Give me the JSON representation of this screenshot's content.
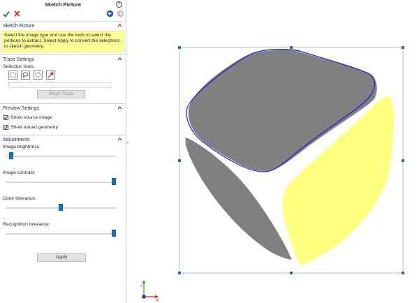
{
  "panel": {
    "title": "Sketch Picture",
    "help_icon": "?",
    "ok_icon": "check-icon",
    "cancel_icon": "x-icon"
  },
  "sketch_picture": {
    "heading": "Sketch Picture",
    "message": "Select the image type and use the tools to select the portions to extract. Select Apply to convert the selections to sketch geometry."
  },
  "trace_settings": {
    "heading": "Trace Settings",
    "selection_label": "Selection tools:",
    "tools": [
      "rectangle-select-icon",
      "lasso-select-icon",
      "polygon-select-icon",
      "color-picker-icon"
    ],
    "begin_trace": "Begin Trace"
  },
  "preview_settings": {
    "heading": "Preview Settings",
    "show_source": "Show source image",
    "show_traced": "Show traced geometry"
  },
  "adjustments": {
    "heading": "Adjustments",
    "brightness_label": "Image brightness:",
    "brightness_value": 0.03,
    "contrast_label": "Image contrast:",
    "contrast_value": 1.0,
    "color_tol_label": "Color tolerance:",
    "color_tol_value": 0.5,
    "recog_tol_label": "Recognition tolerance:",
    "recog_tol_value": 1.0,
    "apply": "Apply"
  },
  "colors": {
    "accent": "#1674c4",
    "message_bg": "#ffff99",
    "gray_face": "#808080",
    "yellow_face": "#ffff80",
    "trace_line": "#1a1ad8",
    "handle": "#3a66a8"
  },
  "triad": {
    "x": "X",
    "y": "Y"
  }
}
